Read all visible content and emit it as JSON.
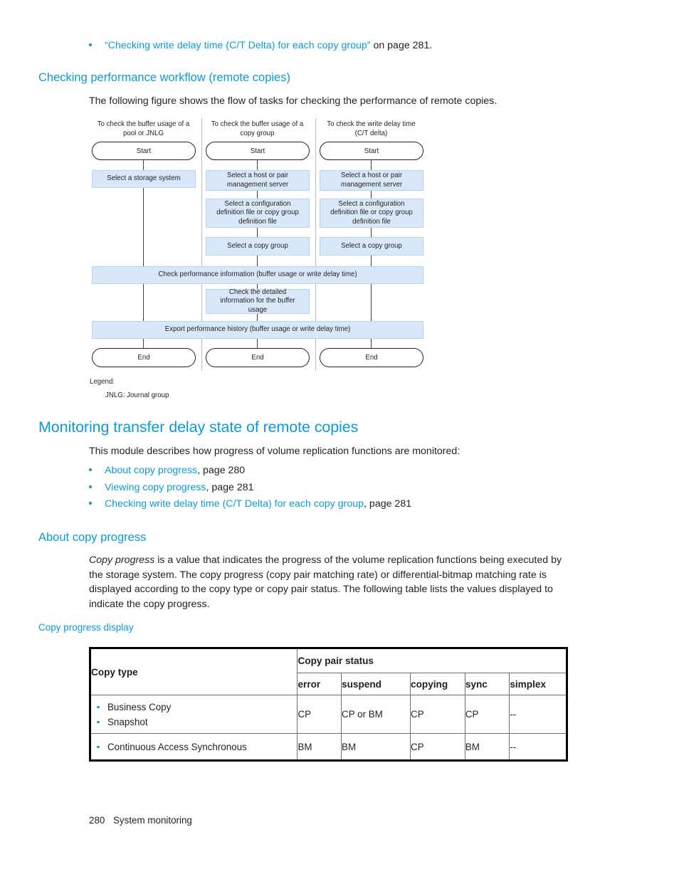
{
  "top_bullet": {
    "link": "“Checking write delay time (C/T Delta) for each copy group”",
    "suffix": " on page 281."
  },
  "section_workflow": {
    "heading": "Checking performance workflow (remote copies)",
    "intro": "The following figure shows the flow of tasks for checking the performance of remote copies."
  },
  "flowchart": {
    "columns": [
      {
        "title": "To check the buffer usage of a\npool or JNLG",
        "start": "Start",
        "end": "End",
        "steps": [
          "Select a storage system"
        ]
      },
      {
        "title": "To check the buffer usage of a\ncopy group",
        "start": "Start",
        "end": "End",
        "steps": [
          "Select a host or pair\nmanagement server",
          "Select a configuration\ndefinition file or copy group\ndefinition file",
          "Select a copy group"
        ],
        "detail_box": "Check the detailed\ninformation for the buffer\nusage"
      },
      {
        "title": "To check the write delay time\n(C/T delta)",
        "start": "Start",
        "end": "End",
        "steps": [
          "Select a host or pair\nmanagement server",
          "Select a configuration\ndefinition file or copy group\ndefinition file",
          "Select a copy group"
        ]
      }
    ],
    "wide_bars": [
      "Check performance information (buffer usage or write delay time)",
      "Export performance history (buffer usage or write delay time)"
    ],
    "legend_title": "Legend:",
    "legend_entry": "JNLG: Journal group",
    "box_fill": "#d8e8f8"
  },
  "section_monitoring": {
    "heading": "Monitoring transfer delay state of remote copies",
    "intro": "This module describes how progress of volume replication functions are monitored:",
    "links": [
      {
        "link": "About copy progress",
        "suffix": ", page 280"
      },
      {
        "link": "Viewing copy progress",
        "suffix": ", page 281"
      },
      {
        "link": "Checking write delay time (C/T Delta) for each copy group",
        "suffix": ", page 281"
      }
    ]
  },
  "section_about": {
    "heading": "About copy progress",
    "paragraph_italic": "Copy progress",
    "paragraph_rest": " is a value that indicates the progress of the volume replication functions being executed by the storage system. The copy progress (copy pair matching rate) or differential-bitmap matching rate is displayed according to the copy type or copy pair status. The following table lists the values displayed to indicate the copy progress.",
    "table_caption": "Copy progress display"
  },
  "table": {
    "col_copy_type": "Copy type",
    "group_header": "Copy pair status",
    "status_headers": [
      "error",
      "suspend",
      "copying",
      "sync",
      "simplex"
    ],
    "rows": [
      {
        "types": [
          "Business Copy",
          "Snapshot"
        ],
        "values": [
          "CP",
          "CP or BM",
          "CP",
          "CP",
          "--"
        ]
      },
      {
        "types": [
          "Continuous Access Synchronous"
        ],
        "values": [
          "BM",
          "BM",
          "CP",
          "BM",
          "--"
        ]
      }
    ]
  },
  "footer": {
    "page_number": "280",
    "chapter": "System monitoring"
  },
  "colors": {
    "accent": "#0b9bd8",
    "text": "#231f20",
    "flow_fill": "#d8e8f8"
  }
}
